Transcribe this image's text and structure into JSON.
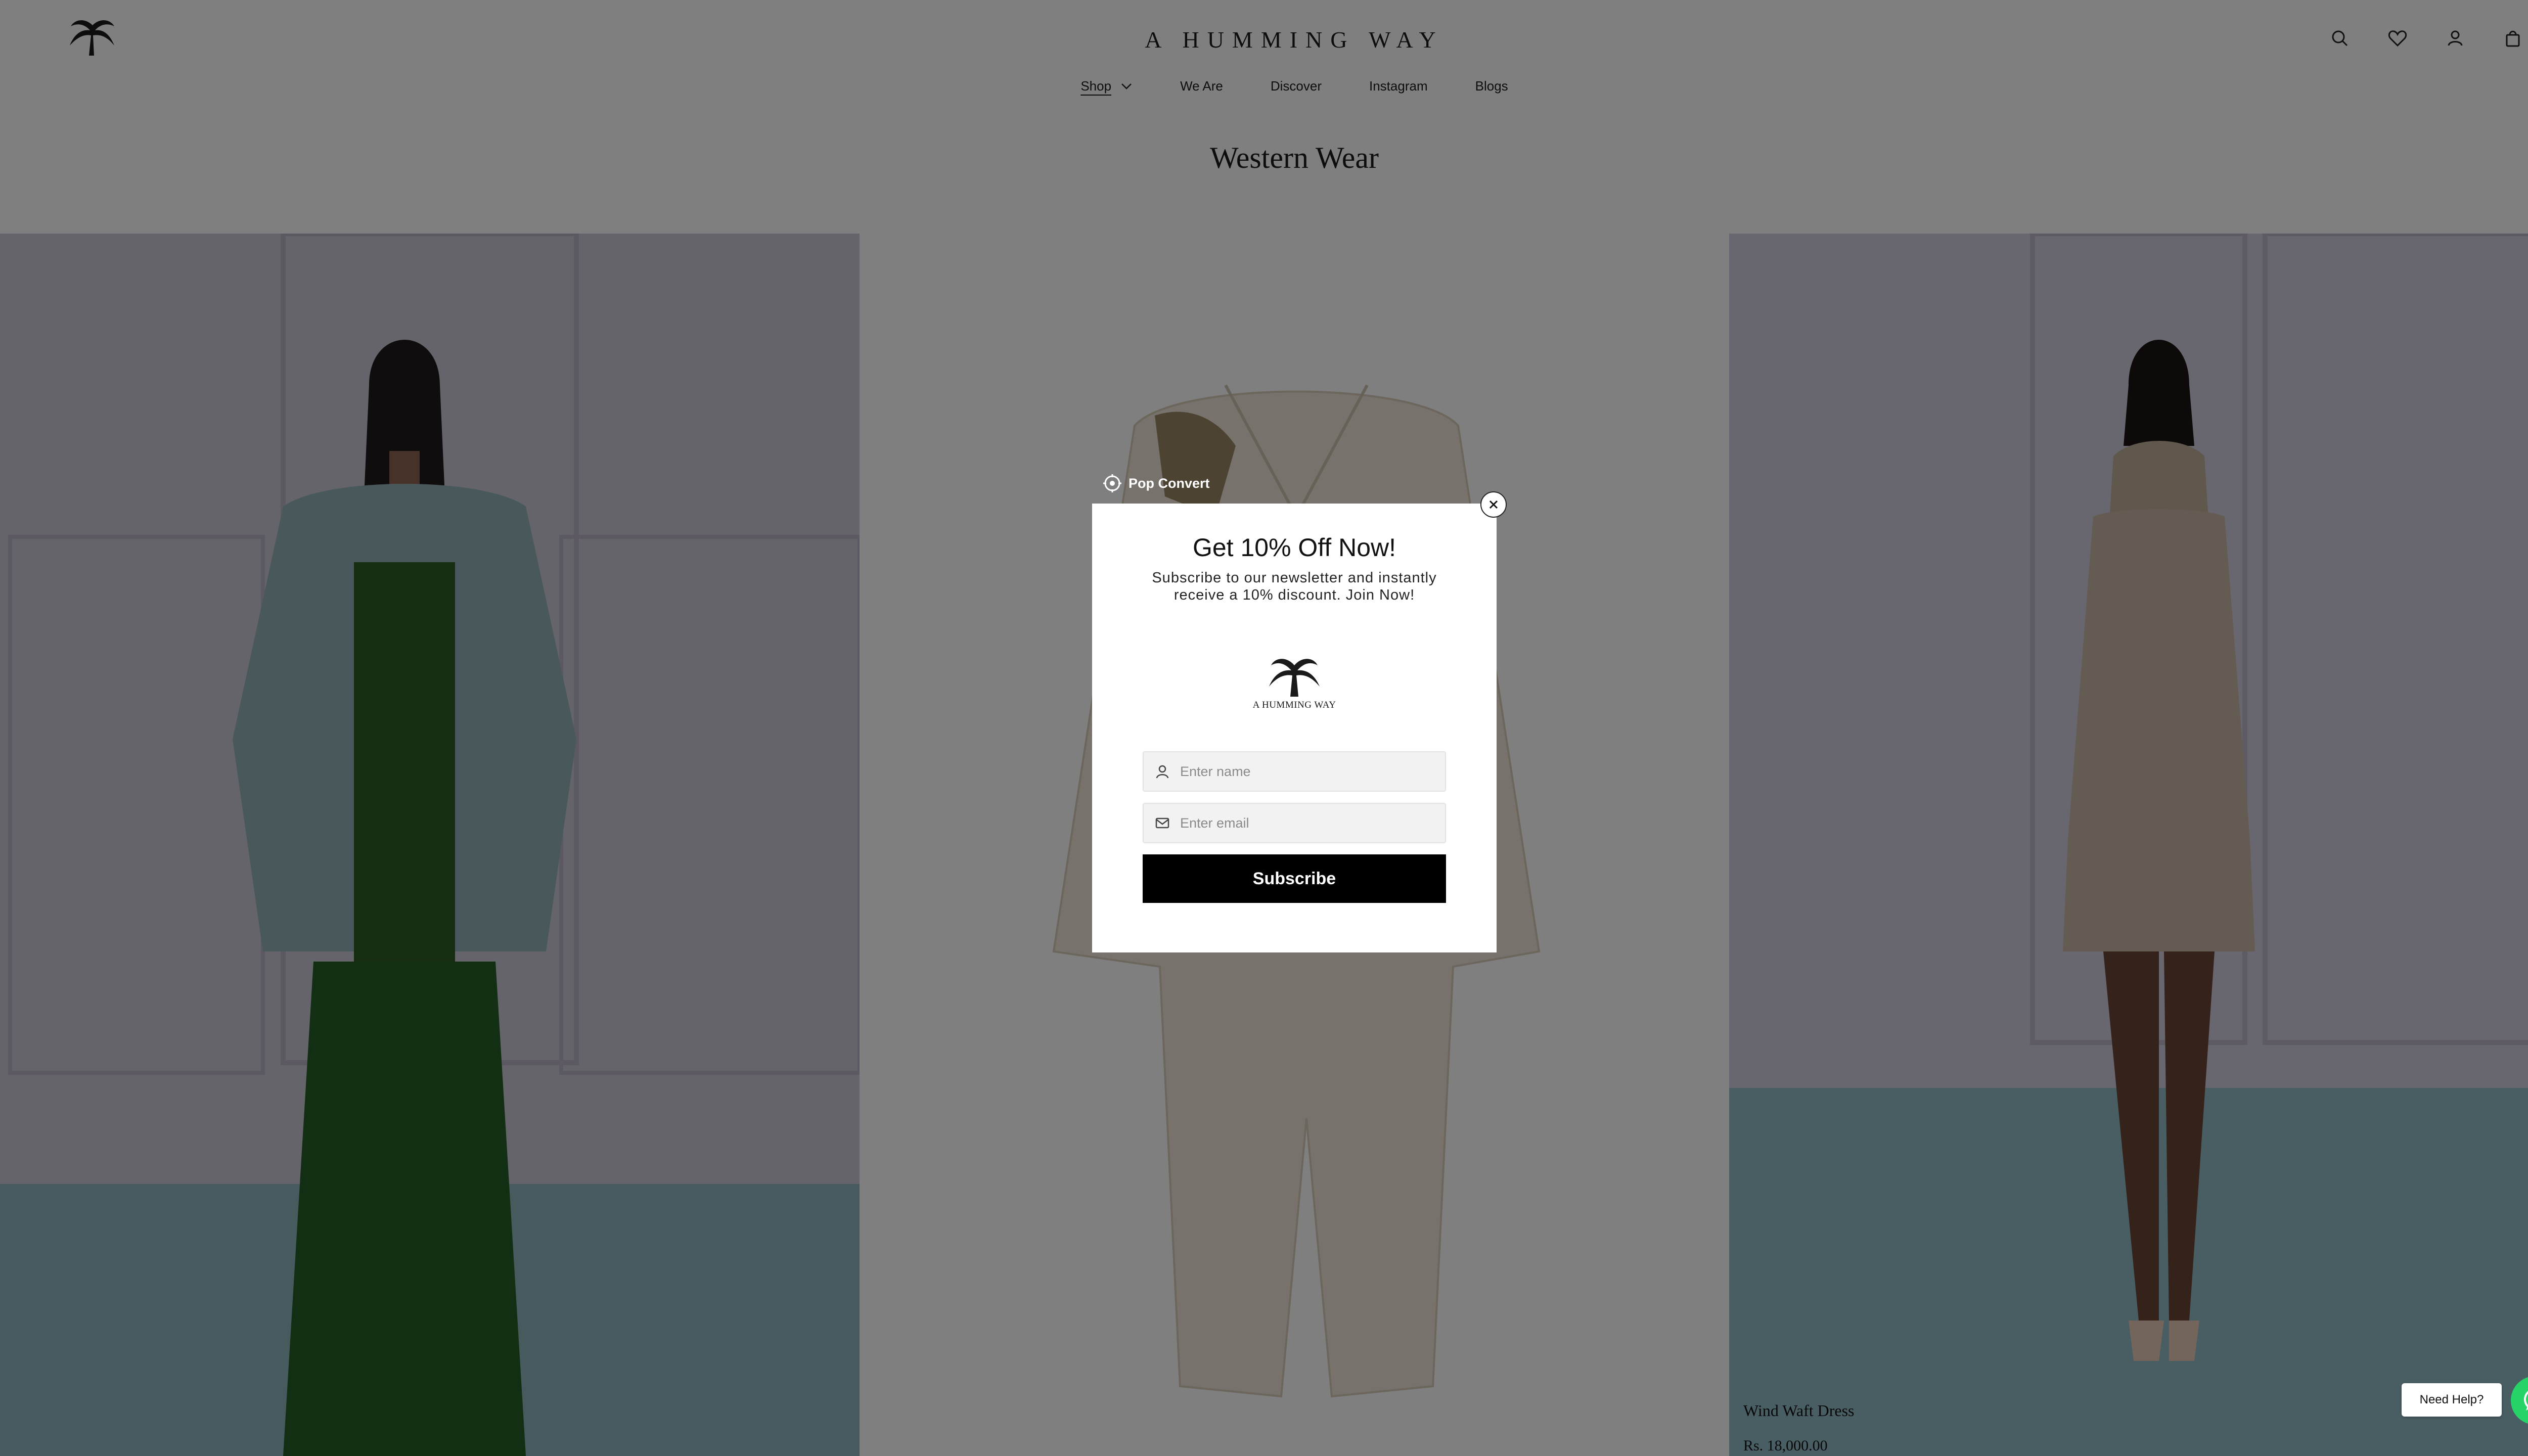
{
  "header": {
    "brand": "A HUMMING WAY",
    "icons": [
      "search-icon",
      "heart-icon",
      "user-icon",
      "bag-icon"
    ]
  },
  "nav": {
    "items": [
      {
        "label": "Shop"
      },
      {
        "label": "We Are"
      },
      {
        "label": "Discover"
      },
      {
        "label": "Instagram"
      },
      {
        "label": "Blogs"
      }
    ]
  },
  "page": {
    "title": "Western Wear"
  },
  "products": [
    {
      "name": "Wind Waft Dress",
      "price": "Rs. 18,000.00"
    }
  ],
  "popup": {
    "provider": "Pop Convert",
    "title": "Get 10% Off Now!",
    "subtitle": "Subscribe to our newsletter and instantly receive a 10% discount. Join Now!",
    "logo_text": "A HUMMING WAY",
    "name_placeholder": "Enter name",
    "email_placeholder": "Enter email",
    "button_label": "Subscribe"
  },
  "help": {
    "label": "Need Help?"
  },
  "colors": {
    "overlay": "#000000",
    "whatsapp": "#25d366",
    "button": "#000000"
  }
}
